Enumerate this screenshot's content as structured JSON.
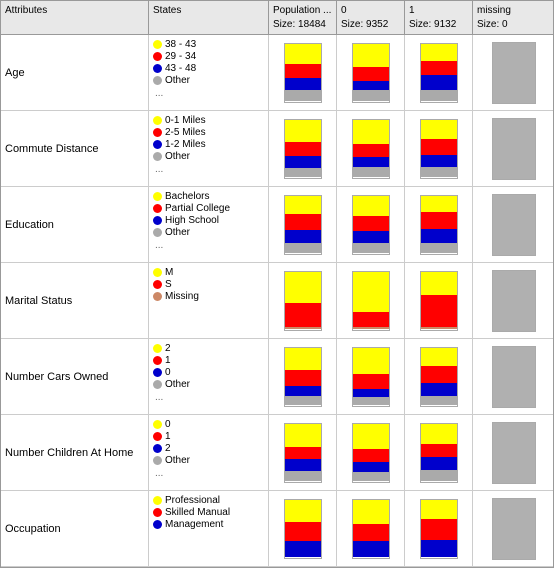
{
  "header": {
    "attributes_label": "Attributes",
    "states_label": "States",
    "population_label": "Population ...",
    "population_size": "Size: 18484",
    "col0_label": "0",
    "col0_size": "Size: 9352",
    "col1_label": "1",
    "col1_size": "Size: 9132",
    "missing_label": "missing",
    "missing_size": "Size: 0"
  },
  "rows": [
    {
      "id": "age",
      "attr": "Age",
      "states": [
        {
          "color": "#ffff00",
          "label": "38 - 43"
        },
        {
          "color": "#ff0000",
          "label": "29 - 34"
        },
        {
          "color": "#0000cc",
          "label": "43 - 48"
        },
        {
          "color": "#aaaaaa",
          "label": "Other"
        }
      ],
      "has_ellipsis": true,
      "charts": [
        {
          "segments": [
            {
              "color": "#ffff00",
              "pct": 35
            },
            {
              "color": "#ff0000",
              "pct": 25
            },
            {
              "color": "#0000cc",
              "pct": 20
            },
            {
              "color": "#aaaaaa",
              "pct": 20
            }
          ]
        },
        {
          "segments": [
            {
              "color": "#ffff00",
              "pct": 40
            },
            {
              "color": "#ff0000",
              "pct": 25
            },
            {
              "color": "#0000cc",
              "pct": 15
            },
            {
              "color": "#aaaaaa",
              "pct": 20
            }
          ]
        },
        {
          "segments": [
            {
              "color": "#ffff00",
              "pct": 30
            },
            {
              "color": "#ff0000",
              "pct": 25
            },
            {
              "color": "#0000cc",
              "pct": 25
            },
            {
              "color": "#aaaaaa",
              "pct": 20
            }
          ]
        }
      ]
    },
    {
      "id": "commute-distance",
      "attr": "Commute Distance",
      "states": [
        {
          "color": "#ffff00",
          "label": "0-1 Miles"
        },
        {
          "color": "#ff0000",
          "label": "2-5 Miles"
        },
        {
          "color": "#0000cc",
          "label": "1-2 Miles"
        },
        {
          "color": "#aaaaaa",
          "label": "Other"
        }
      ],
      "has_ellipsis": true,
      "charts": [
        {
          "segments": [
            {
              "color": "#ffff00",
              "pct": 38
            },
            {
              "color": "#ff0000",
              "pct": 25
            },
            {
              "color": "#0000cc",
              "pct": 20
            },
            {
              "color": "#aaaaaa",
              "pct": 17
            }
          ]
        },
        {
          "segments": [
            {
              "color": "#ffff00",
              "pct": 42
            },
            {
              "color": "#ff0000",
              "pct": 22
            },
            {
              "color": "#0000cc",
              "pct": 18
            },
            {
              "color": "#aaaaaa",
              "pct": 18
            }
          ]
        },
        {
          "segments": [
            {
              "color": "#ffff00",
              "pct": 34
            },
            {
              "color": "#ff0000",
              "pct": 28
            },
            {
              "color": "#0000cc",
              "pct": 20
            },
            {
              "color": "#aaaaaa",
              "pct": 18
            }
          ]
        }
      ]
    },
    {
      "id": "education",
      "attr": "Education",
      "states": [
        {
          "color": "#ffff00",
          "label": "Bachelors"
        },
        {
          "color": "#ff0000",
          "label": "Partial College"
        },
        {
          "color": "#0000cc",
          "label": "High School"
        },
        {
          "color": "#aaaaaa",
          "label": "Other"
        }
      ],
      "has_ellipsis": true,
      "charts": [
        {
          "segments": [
            {
              "color": "#ffff00",
              "pct": 32
            },
            {
              "color": "#ff0000",
              "pct": 28
            },
            {
              "color": "#0000cc",
              "pct": 22
            },
            {
              "color": "#aaaaaa",
              "pct": 18
            }
          ]
        },
        {
          "segments": [
            {
              "color": "#ffff00",
              "pct": 36
            },
            {
              "color": "#ff0000",
              "pct": 26
            },
            {
              "color": "#0000cc",
              "pct": 20
            },
            {
              "color": "#aaaaaa",
              "pct": 18
            }
          ]
        },
        {
          "segments": [
            {
              "color": "#ffff00",
              "pct": 28
            },
            {
              "color": "#ff0000",
              "pct": 30
            },
            {
              "color": "#0000cc",
              "pct": 24
            },
            {
              "color": "#aaaaaa",
              "pct": 18
            }
          ]
        }
      ]
    },
    {
      "id": "marital-status",
      "attr": "Marital Status",
      "states": [
        {
          "color": "#ffff00",
          "label": "M"
        },
        {
          "color": "#ff0000",
          "label": "S"
        },
        {
          "color": "#cc8866",
          "label": "Missing"
        }
      ],
      "has_ellipsis": false,
      "charts": [
        {
          "segments": [
            {
              "color": "#ffff00",
              "pct": 55
            },
            {
              "color": "#ff0000",
              "pct": 40
            },
            {
              "color": "#cc8866",
              "pct": 5
            }
          ]
        },
        {
          "segments": [
            {
              "color": "#ffff00",
              "pct": 70
            },
            {
              "color": "#ff0000",
              "pct": 25
            },
            {
              "color": "#cc8866",
              "pct": 5
            }
          ]
        },
        {
          "segments": [
            {
              "color": "#ffff00",
              "pct": 40
            },
            {
              "color": "#ff0000",
              "pct": 55
            },
            {
              "color": "#cc8866",
              "pct": 5
            }
          ]
        }
      ]
    },
    {
      "id": "number-cars-owned",
      "attr": "Number Cars Owned",
      "states": [
        {
          "color": "#ffff00",
          "label": "2"
        },
        {
          "color": "#ff0000",
          "label": "1"
        },
        {
          "color": "#0000cc",
          "label": "0"
        },
        {
          "color": "#aaaaaa",
          "label": "Other"
        }
      ],
      "has_ellipsis": true,
      "charts": [
        {
          "segments": [
            {
              "color": "#ffff00",
              "pct": 38
            },
            {
              "color": "#ff0000",
              "pct": 28
            },
            {
              "color": "#0000cc",
              "pct": 18
            },
            {
              "color": "#aaaaaa",
              "pct": 16
            }
          ]
        },
        {
          "segments": [
            {
              "color": "#ffff00",
              "pct": 45
            },
            {
              "color": "#ff0000",
              "pct": 27
            },
            {
              "color": "#0000cc",
              "pct": 14
            },
            {
              "color": "#aaaaaa",
              "pct": 14
            }
          ]
        },
        {
          "segments": [
            {
              "color": "#ffff00",
              "pct": 32
            },
            {
              "color": "#ff0000",
              "pct": 29
            },
            {
              "color": "#0000cc",
              "pct": 22
            },
            {
              "color": "#aaaaaa",
              "pct": 17
            }
          ]
        }
      ]
    },
    {
      "id": "number-children",
      "attr": "Number Children At Home",
      "states": [
        {
          "color": "#ffff00",
          "label": "0"
        },
        {
          "color": "#ff0000",
          "label": "1"
        },
        {
          "color": "#0000cc",
          "label": "2"
        },
        {
          "color": "#aaaaaa",
          "label": "Other"
        }
      ],
      "has_ellipsis": true,
      "charts": [
        {
          "segments": [
            {
              "color": "#ffff00",
              "pct": 40
            },
            {
              "color": "#ff0000",
              "pct": 22
            },
            {
              "color": "#0000cc",
              "pct": 20
            },
            {
              "color": "#aaaaaa",
              "pct": 18
            }
          ]
        },
        {
          "segments": [
            {
              "color": "#ffff00",
              "pct": 44
            },
            {
              "color": "#ff0000",
              "pct": 22
            },
            {
              "color": "#0000cc",
              "pct": 18
            },
            {
              "color": "#aaaaaa",
              "pct": 16
            }
          ]
        },
        {
          "segments": [
            {
              "color": "#ffff00",
              "pct": 36
            },
            {
              "color": "#ff0000",
              "pct": 22
            },
            {
              "color": "#0000cc",
              "pct": 22
            },
            {
              "color": "#aaaaaa",
              "pct": 20
            }
          ]
        }
      ]
    },
    {
      "id": "occupation",
      "attr": "Occupation",
      "states": [
        {
          "color": "#ffff00",
          "label": "Professional"
        },
        {
          "color": "#ff0000",
          "label": "Skilled Manual"
        },
        {
          "color": "#0000cc",
          "label": "Management"
        }
      ],
      "has_ellipsis": false,
      "charts": [
        {
          "segments": [
            {
              "color": "#ffff00",
              "pct": 38
            },
            {
              "color": "#ff0000",
              "pct": 33
            },
            {
              "color": "#0000cc",
              "pct": 29
            }
          ]
        },
        {
          "segments": [
            {
              "color": "#ffff00",
              "pct": 42
            },
            {
              "color": "#ff0000",
              "pct": 30
            },
            {
              "color": "#0000cc",
              "pct": 28
            }
          ]
        },
        {
          "segments": [
            {
              "color": "#ffff00",
              "pct": 34
            },
            {
              "color": "#ff0000",
              "pct": 36
            },
            {
              "color": "#0000cc",
              "pct": 30
            }
          ]
        }
      ]
    }
  ]
}
